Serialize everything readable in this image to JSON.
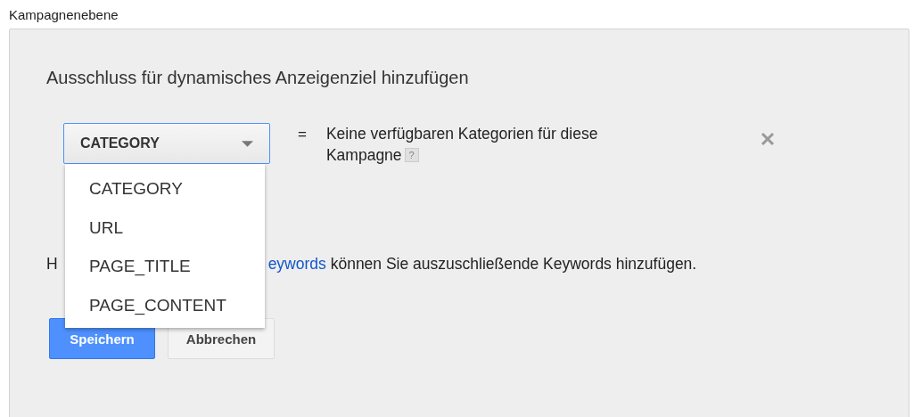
{
  "section_label": "Kampagnenebene",
  "panel": {
    "title": "Ausschluss für dynamisches Anzeigenziel hinzufügen",
    "condition": {
      "field": {
        "value": "CATEGORY",
        "expanded": true,
        "focused": true
      },
      "operator": "=",
      "value_lines": [
        "Keine verfügbaren Kategorien für diese",
        "Kampagne"
      ],
      "help": "?"
    },
    "options": [
      {
        "label": "CATEGORY",
        "selected": false
      },
      {
        "label": "URL",
        "selected": false
      },
      {
        "label": "PAGE_TITLE",
        "selected": false
      },
      {
        "label": "PAGE_CONTENT",
        "selected": false
      }
    ],
    "hint": {
      "lead": "H",
      "link": "eywords",
      "rest": " können Sie auszuschließende Keywords hinzufügen."
    },
    "buttons": [
      {
        "label": "Speichern",
        "kind": "primary"
      },
      {
        "label": "Abbrechen",
        "kind": "secondary"
      }
    ]
  }
}
